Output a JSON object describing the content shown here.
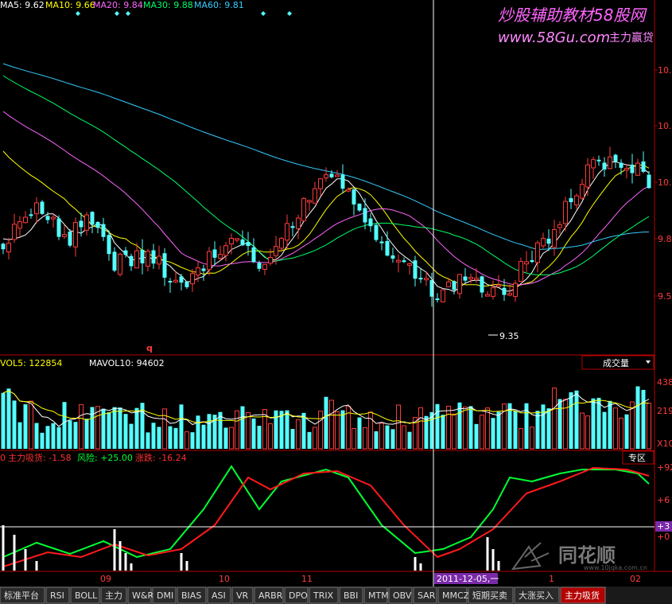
{
  "header": {
    "ma": [
      {
        "label": "MA5:",
        "value": "9.62",
        "color": "#ffffff"
      },
      {
        "label": "MA10:",
        "value": "9.66",
        "color": "#ffff00"
      },
      {
        "label": "MA20:",
        "value": "9.84",
        "color": "#ff66ff"
      },
      {
        "label": "MA30:",
        "value": "9.88",
        "color": "#00ff66"
      },
      {
        "label": "MA60:",
        "value": "9.81",
        "color": "#33ccff"
      }
    ]
  },
  "watermark": {
    "title": "炒股辅助教材58股网",
    "url": "www.58Gu.com",
    "slogan": "主力赢贷"
  },
  "logo": {
    "name": "同花顺",
    "url": "www.10jqka.com.cn"
  },
  "colors": {
    "up": "#ff3b3b",
    "down": "#54ffff",
    "ma5": "#ffffff",
    "ma10": "#ffff00",
    "ma20": "#ff66ff",
    "ma30": "#00ff66",
    "ma60": "#33ccff",
    "axis": "#b40000",
    "kdj_green": "#00ff33",
    "kdj_red": "#ff1a1a"
  },
  "price_axis": {
    "labels": [
      "10.",
      "10.",
      "10.",
      "9.8",
      "9.5"
    ]
  },
  "price_marker": {
    "low_label": "9.35",
    "q_label": "q"
  },
  "vol": {
    "vol5_label": "VOL5:",
    "vol5_value": "122854",
    "mavol_label": "MAVOL10:",
    "mavol_value": "94602",
    "left_label": "0",
    "selector": "成交量",
    "axis_labels": [
      "438",
      "219",
      "X10"
    ]
  },
  "indicator": {
    "left_label": "0",
    "items": [
      {
        "label": "主力吸货:",
        "value": "-1.58",
        "color": "#ff3030"
      },
      {
        "label": "风险:",
        "value": "+25.00",
        "color": "#00ff33"
      },
      {
        "label": "涨跌:",
        "value": "-16.24",
        "color": "#ff3030"
      }
    ],
    "button": "专区",
    "axis_labels": [
      "+92",
      "+6",
      "+3",
      "+0"
    ]
  },
  "date_axis": {
    "labels": [
      "09",
      "10",
      "11",
      "1",
      "02"
    ],
    "cursor_date": "2011-12-05,一"
  },
  "tabs": [
    "标准平台",
    "RSI",
    "BOLL",
    "主力",
    "W&R",
    "DMI",
    "BIAS",
    "ASI",
    "VR",
    "ARBR",
    "DPO",
    "TRIX",
    "BBI",
    "MTM",
    "OBV",
    "SAR",
    "MMCZ",
    "短期买卖",
    "大涨买入",
    "主力吸货"
  ],
  "active_tab": "主力吸货",
  "chart_data": {
    "type": "candlestick",
    "y_axis_ticks": [
      "10.",
      "10.",
      "10.",
      "9.8",
      "9.5"
    ],
    "visible_low": 9.35,
    "moving_averages": [
      {
        "name": "MA5",
        "last": 9.62
      },
      {
        "name": "MA10",
        "last": 9.66
      },
      {
        "name": "MA20",
        "last": 9.84
      },
      {
        "name": "MA30",
        "last": 9.88
      },
      {
        "name": "MA60",
        "last": 9.81
      }
    ],
    "volume_panel": {
      "VOL5": 122854,
      "MAVOL10": 94602,
      "axis": [
        438,
        219
      ]
    },
    "indicator_panel": {
      "主力吸货": -1.58,
      "风险": 25.0,
      "涨跌": -16.24,
      "axis": [
        92,
        6,
        3,
        0
      ]
    },
    "x_axis_ticks": [
      "09",
      "10",
      "11",
      "1",
      "02"
    ],
    "cursor_date": "2011-12-05,一"
  }
}
